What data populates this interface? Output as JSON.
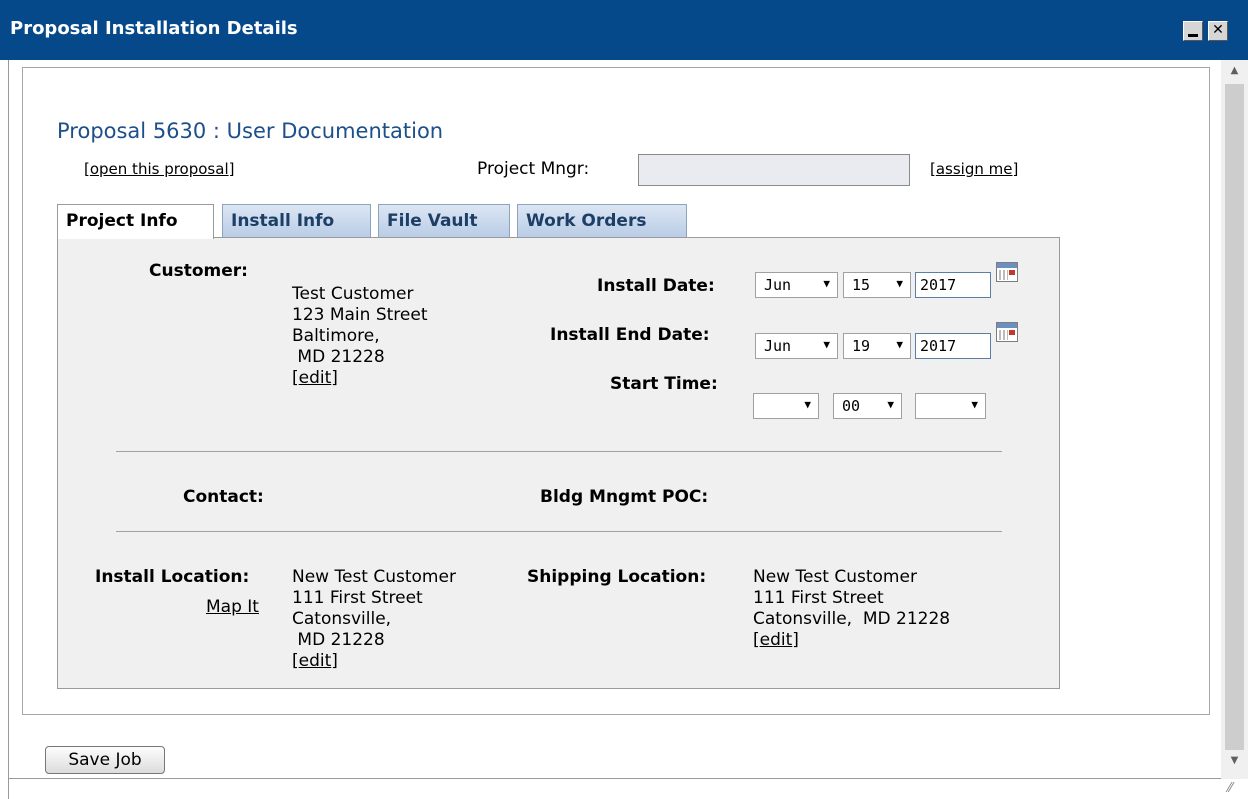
{
  "window": {
    "title": "Proposal Installation Details",
    "minimize_glyph": "_",
    "close_glyph": "✕"
  },
  "heading": "Proposal 5630 : User Documentation",
  "links": {
    "open_proposal": "open this proposal",
    "assign_me": "assign me"
  },
  "project_mngr": {
    "label": "Project Mngr:",
    "value": ""
  },
  "tabs": [
    {
      "label": "Project Info",
      "active": true
    },
    {
      "label": "Install Info",
      "active": false
    },
    {
      "label": "File Vault",
      "active": false
    },
    {
      "label": "Work Orders",
      "active": false
    }
  ],
  "customer": {
    "label": "Customer:",
    "name": "Test Customer",
    "street": "123 Main Street",
    "city": "Baltimore,",
    "state_zip": " MD 21228",
    "edit": "edit"
  },
  "install_date": {
    "label": "Install Date:",
    "month": "Jun",
    "day": "15",
    "year": "2017"
  },
  "install_end_date": {
    "label": "Install End Date:",
    "month": "Jun",
    "day": "19",
    "year": "2017"
  },
  "start_time": {
    "label": "Start Time:",
    "hour": "",
    "minute": "00",
    "ampm": ""
  },
  "contact": {
    "label": "Contact:"
  },
  "bldg_poc": {
    "label": "Bldg Mngmt POC:"
  },
  "install_location": {
    "label": "Install Location:",
    "map_link": "Map It",
    "name": "New Test Customer",
    "street": "111 First Street",
    "city": "Catonsville,",
    "state_zip": " MD 21228",
    "edit": "edit"
  },
  "shipping_location": {
    "label": "Shipping Location:",
    "name": "New Test Customer",
    "street": "111 First Street",
    "city_state_zip": "Catonsville,  MD 21228",
    "edit": "edit"
  },
  "save_button": "Save Job",
  "colors": {
    "titlebar": "#05498a",
    "heading": "#1d4f8a",
    "tab_panel": "#f0f0f0"
  }
}
